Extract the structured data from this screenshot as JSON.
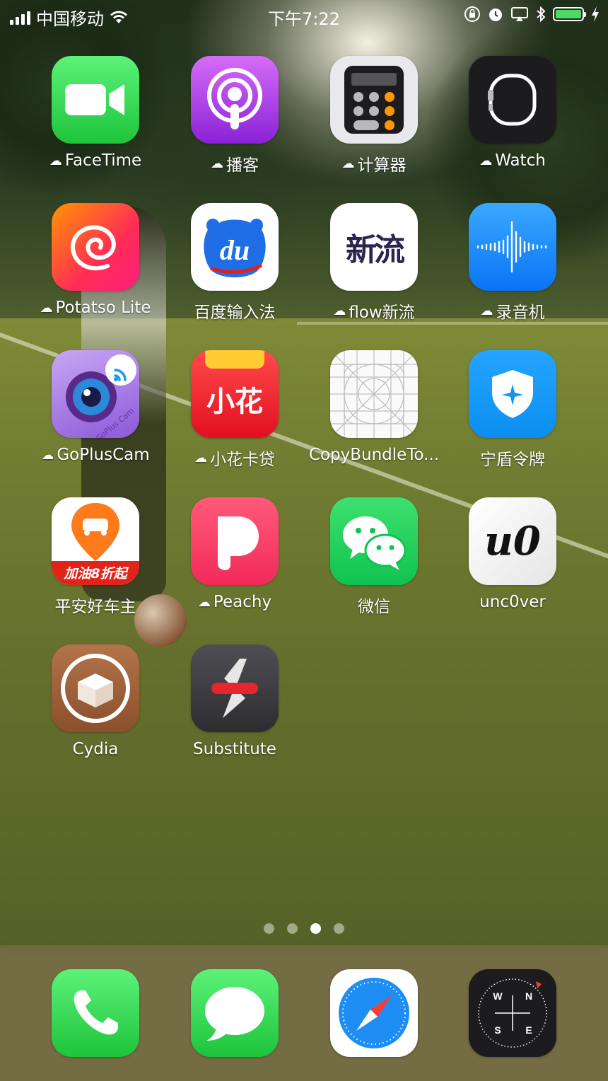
{
  "status_bar": {
    "carrier": "中国移动",
    "time": "下午7:22",
    "battery_level": 1.0,
    "battery_color": "#4cd964"
  },
  "home_screen": {
    "apps": [
      {
        "label": "FaceTime",
        "icon": "facetime-icon",
        "icloud": true
      },
      {
        "label": "播客",
        "icon": "podcasts-icon",
        "icloud": true
      },
      {
        "label": "计算器",
        "icon": "calculator-icon",
        "icloud": true
      },
      {
        "label": "Watch",
        "icon": "watch-icon",
        "icloud": true
      },
      {
        "label": "Potatso Lite",
        "icon": "potatso-icon",
        "icloud": true
      },
      {
        "label": "百度输入法",
        "icon": "baidu-ime-icon",
        "icloud": false
      },
      {
        "label": "flow新流",
        "icon": "flow-icon",
        "icloud": true
      },
      {
        "label": "录音机",
        "icon": "voice-memos-icon",
        "icloud": true
      },
      {
        "label": "GoPlusCam",
        "icon": "gopluscam-icon",
        "icloud": true
      },
      {
        "label": "小花卡贷",
        "icon": "xiaohua-icon",
        "icloud": true
      },
      {
        "label": "CopyBundleTo...",
        "icon": "copybundle-icon",
        "icloud": false
      },
      {
        "label": "宁盾令牌",
        "icon": "ningdun-icon",
        "icloud": false
      },
      {
        "label": "平安好车主",
        "icon": "pingan-icon",
        "icloud": false
      },
      {
        "label": "Peachy",
        "icon": "peachy-icon",
        "icloud": true
      },
      {
        "label": "微信",
        "icon": "wechat-icon",
        "icloud": false
      },
      {
        "label": "unc0ver",
        "icon": "uncover-icon",
        "icloud": false
      },
      {
        "label": "Cydia",
        "icon": "cydia-icon",
        "icloud": false
      },
      {
        "label": "Substitute",
        "icon": "substitute-icon",
        "icloud": false
      }
    ],
    "icon_text": {
      "baidu": "du",
      "flow": "新流",
      "xiaohua": "小花",
      "gopluscam": "GoPlus Cam",
      "pingan": "加油8折起",
      "uncover": "u0"
    },
    "page_dots": {
      "count": 4,
      "active_index": 2
    }
  },
  "dock": {
    "apps": [
      {
        "name": "Phone",
        "icon": "phone-icon"
      },
      {
        "name": "Messages",
        "icon": "messages-icon"
      },
      {
        "name": "Safari",
        "icon": "safari-icon"
      },
      {
        "name": "Compass",
        "icon": "compass-icon"
      }
    ],
    "compass_letters": {
      "n": "N",
      "s": "S",
      "e": "E",
      "w": "W"
    }
  }
}
